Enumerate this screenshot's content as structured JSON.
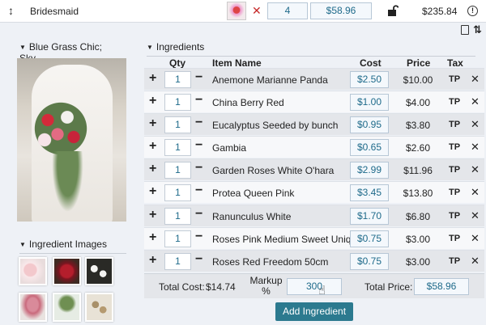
{
  "topbar": {
    "title": "Bridesmaid",
    "quantity": "4",
    "unit_price": "$58.96",
    "total": "$235.84"
  },
  "left_panel": {
    "arrangement_label": "Blue Grass Chic; Sky...",
    "images_label": "Ingredient Images"
  },
  "ingredients": {
    "label": "Ingredients",
    "columns": {
      "qty": "Qty",
      "item": "Item Name",
      "cost": "Cost",
      "price": "Price",
      "tax": "Tax"
    },
    "rows": [
      {
        "qty": "1",
        "name": "Anemone Marianne Panda",
        "cost": "$2.50",
        "price": "$10.00",
        "tax": "TP"
      },
      {
        "qty": "1",
        "name": "China Berry Red",
        "cost": "$1.00",
        "price": "$4.00",
        "tax": "TP"
      },
      {
        "qty": "1",
        "name": "Eucalyptus Seeded by bunch",
        "cost": "$0.95",
        "price": "$3.80",
        "tax": "TP"
      },
      {
        "qty": "1",
        "name": "Gambia",
        "cost": "$0.65",
        "price": "$2.60",
        "tax": "TP"
      },
      {
        "qty": "1",
        "name": "Garden Roses White O'hara",
        "cost": "$2.99",
        "price": "$11.96",
        "tax": "TP"
      },
      {
        "qty": "1",
        "name": "Protea Queen Pink",
        "cost": "$3.45",
        "price": "$13.80",
        "tax": "TP"
      },
      {
        "qty": "1",
        "name": "Ranunculus White",
        "cost": "$1.70",
        "price": "$6.80",
        "tax": "TP"
      },
      {
        "qty": "1",
        "name": "Roses Pink Medium Sweet Unique",
        "cost": "$0.75",
        "price": "$3.00",
        "tax": "TP"
      },
      {
        "qty": "1",
        "name": "Roses Red Freedom 50cm",
        "cost": "$0.75",
        "price": "$3.00",
        "tax": "TP"
      }
    ]
  },
  "footer": {
    "total_cost_label": "Total Cost:",
    "total_cost_value": "$14.74",
    "markup_label": "Markup %",
    "markup_value": "300",
    "total_price_label": "Total Price:",
    "total_price_value": "$58.96"
  },
  "add_button_label": "Add Ingredient",
  "colors": {
    "accent": "#2c7a8f",
    "value_text": "#1e6a8a",
    "remove_red": "#c62828"
  }
}
